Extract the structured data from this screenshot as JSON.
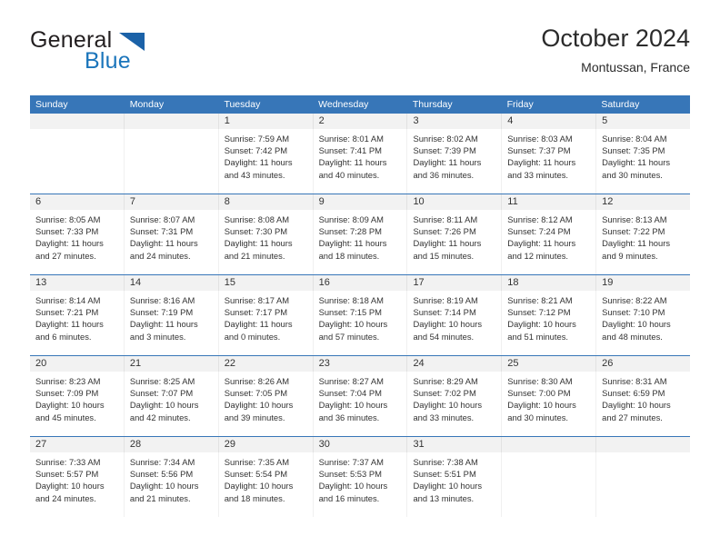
{
  "brand": {
    "word1": "General",
    "word2": "Blue",
    "triangle_color": "#1b62a8",
    "blue_color": "#1b75bb"
  },
  "header": {
    "title": "October 2024",
    "subtitle": "Montussan, France"
  },
  "theme": {
    "header_blue": "#3776b8",
    "number_band": "#f2f2f2"
  },
  "calendar": {
    "weekday_headers": [
      "Sunday",
      "Monday",
      "Tuesday",
      "Wednesday",
      "Thursday",
      "Friday",
      "Saturday"
    ],
    "weeks": [
      [
        {
          "day": "",
          "lines": [
            "",
            "",
            "",
            ""
          ]
        },
        {
          "day": "",
          "lines": [
            "",
            "",
            "",
            ""
          ]
        },
        {
          "day": "1",
          "lines": [
            "Sunrise: 7:59 AM",
            "Sunset: 7:42 PM",
            "Daylight: 11 hours",
            "and 43 minutes."
          ]
        },
        {
          "day": "2",
          "lines": [
            "Sunrise: 8:01 AM",
            "Sunset: 7:41 PM",
            "Daylight: 11 hours",
            "and 40 minutes."
          ]
        },
        {
          "day": "3",
          "lines": [
            "Sunrise: 8:02 AM",
            "Sunset: 7:39 PM",
            "Daylight: 11 hours",
            "and 36 minutes."
          ]
        },
        {
          "day": "4",
          "lines": [
            "Sunrise: 8:03 AM",
            "Sunset: 7:37 PM",
            "Daylight: 11 hours",
            "and 33 minutes."
          ]
        },
        {
          "day": "5",
          "lines": [
            "Sunrise: 8:04 AM",
            "Sunset: 7:35 PM",
            "Daylight: 11 hours",
            "and 30 minutes."
          ]
        }
      ],
      [
        {
          "day": "6",
          "lines": [
            "Sunrise: 8:05 AM",
            "Sunset: 7:33 PM",
            "Daylight: 11 hours",
            "and 27 minutes."
          ]
        },
        {
          "day": "7",
          "lines": [
            "Sunrise: 8:07 AM",
            "Sunset: 7:31 PM",
            "Daylight: 11 hours",
            "and 24 minutes."
          ]
        },
        {
          "day": "8",
          "lines": [
            "Sunrise: 8:08 AM",
            "Sunset: 7:30 PM",
            "Daylight: 11 hours",
            "and 21 minutes."
          ]
        },
        {
          "day": "9",
          "lines": [
            "Sunrise: 8:09 AM",
            "Sunset: 7:28 PM",
            "Daylight: 11 hours",
            "and 18 minutes."
          ]
        },
        {
          "day": "10",
          "lines": [
            "Sunrise: 8:11 AM",
            "Sunset: 7:26 PM",
            "Daylight: 11 hours",
            "and 15 minutes."
          ]
        },
        {
          "day": "11",
          "lines": [
            "Sunrise: 8:12 AM",
            "Sunset: 7:24 PM",
            "Daylight: 11 hours",
            "and 12 minutes."
          ]
        },
        {
          "day": "12",
          "lines": [
            "Sunrise: 8:13 AM",
            "Sunset: 7:22 PM",
            "Daylight: 11 hours",
            "and 9 minutes."
          ]
        }
      ],
      [
        {
          "day": "13",
          "lines": [
            "Sunrise: 8:14 AM",
            "Sunset: 7:21 PM",
            "Daylight: 11 hours",
            "and 6 minutes."
          ]
        },
        {
          "day": "14",
          "lines": [
            "Sunrise: 8:16 AM",
            "Sunset: 7:19 PM",
            "Daylight: 11 hours",
            "and 3 minutes."
          ]
        },
        {
          "day": "15",
          "lines": [
            "Sunrise: 8:17 AM",
            "Sunset: 7:17 PM",
            "Daylight: 11 hours",
            "and 0 minutes."
          ]
        },
        {
          "day": "16",
          "lines": [
            "Sunrise: 8:18 AM",
            "Sunset: 7:15 PM",
            "Daylight: 10 hours",
            "and 57 minutes."
          ]
        },
        {
          "day": "17",
          "lines": [
            "Sunrise: 8:19 AM",
            "Sunset: 7:14 PM",
            "Daylight: 10 hours",
            "and 54 minutes."
          ]
        },
        {
          "day": "18",
          "lines": [
            "Sunrise: 8:21 AM",
            "Sunset: 7:12 PM",
            "Daylight: 10 hours",
            "and 51 minutes."
          ]
        },
        {
          "day": "19",
          "lines": [
            "Sunrise: 8:22 AM",
            "Sunset: 7:10 PM",
            "Daylight: 10 hours",
            "and 48 minutes."
          ]
        }
      ],
      [
        {
          "day": "20",
          "lines": [
            "Sunrise: 8:23 AM",
            "Sunset: 7:09 PM",
            "Daylight: 10 hours",
            "and 45 minutes."
          ]
        },
        {
          "day": "21",
          "lines": [
            "Sunrise: 8:25 AM",
            "Sunset: 7:07 PM",
            "Daylight: 10 hours",
            "and 42 minutes."
          ]
        },
        {
          "day": "22",
          "lines": [
            "Sunrise: 8:26 AM",
            "Sunset: 7:05 PM",
            "Daylight: 10 hours",
            "and 39 minutes."
          ]
        },
        {
          "day": "23",
          "lines": [
            "Sunrise: 8:27 AM",
            "Sunset: 7:04 PM",
            "Daylight: 10 hours",
            "and 36 minutes."
          ]
        },
        {
          "day": "24",
          "lines": [
            "Sunrise: 8:29 AM",
            "Sunset: 7:02 PM",
            "Daylight: 10 hours",
            "and 33 minutes."
          ]
        },
        {
          "day": "25",
          "lines": [
            "Sunrise: 8:30 AM",
            "Sunset: 7:00 PM",
            "Daylight: 10 hours",
            "and 30 minutes."
          ]
        },
        {
          "day": "26",
          "lines": [
            "Sunrise: 8:31 AM",
            "Sunset: 6:59 PM",
            "Daylight: 10 hours",
            "and 27 minutes."
          ]
        }
      ],
      [
        {
          "day": "27",
          "lines": [
            "Sunrise: 7:33 AM",
            "Sunset: 5:57 PM",
            "Daylight: 10 hours",
            "and 24 minutes."
          ]
        },
        {
          "day": "28",
          "lines": [
            "Sunrise: 7:34 AM",
            "Sunset: 5:56 PM",
            "Daylight: 10 hours",
            "and 21 minutes."
          ]
        },
        {
          "day": "29",
          "lines": [
            "Sunrise: 7:35 AM",
            "Sunset: 5:54 PM",
            "Daylight: 10 hours",
            "and 18 minutes."
          ]
        },
        {
          "day": "30",
          "lines": [
            "Sunrise: 7:37 AM",
            "Sunset: 5:53 PM",
            "Daylight: 10 hours",
            "and 16 minutes."
          ]
        },
        {
          "day": "31",
          "lines": [
            "Sunrise: 7:38 AM",
            "Sunset: 5:51 PM",
            "Daylight: 10 hours",
            "and 13 minutes."
          ]
        },
        {
          "day": "",
          "lines": [
            "",
            "",
            "",
            ""
          ]
        },
        {
          "day": "",
          "lines": [
            "",
            "",
            "",
            ""
          ]
        }
      ]
    ]
  }
}
